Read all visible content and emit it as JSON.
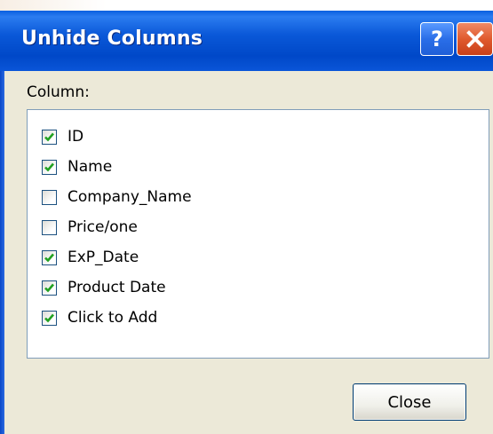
{
  "dialog": {
    "title": "Unhide Columns",
    "help_button": "?",
    "column_label": "Column:",
    "close_label": "Close"
  },
  "columns": [
    {
      "label": "ID",
      "checked": true
    },
    {
      "label": "Name",
      "checked": true
    },
    {
      "label": "Company_Name",
      "checked": false
    },
    {
      "label": "Price/one",
      "checked": false
    },
    {
      "label": "ExP_Date",
      "checked": true
    },
    {
      "label": "Product Date",
      "checked": true
    },
    {
      "label": "Click to Add",
      "checked": true
    }
  ],
  "colors": {
    "titlebar": "#0a58d8",
    "checkmark": "#21a121",
    "checkbox_border": "#1c5180",
    "dialog_bg": "#ece9d8"
  }
}
